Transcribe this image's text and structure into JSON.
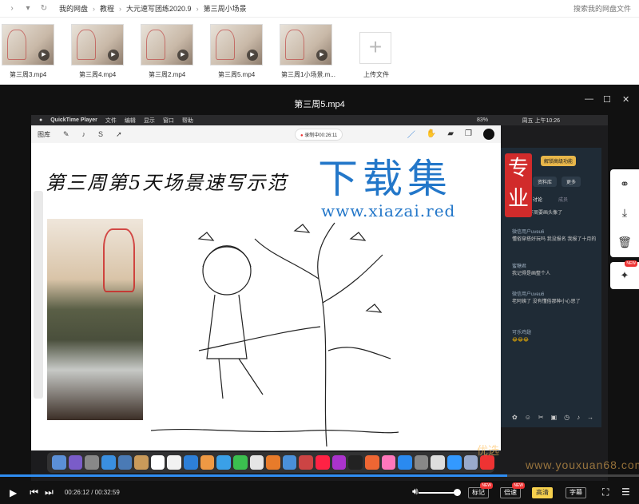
{
  "breadcrumb": [
    "我的网盘",
    "教程",
    "大元速写团练2020.9",
    "第三周小场景"
  ],
  "search": {
    "placeholder": "搜索我的网盘文件"
  },
  "thumbnails": [
    {
      "name": "第三周3.mp4"
    },
    {
      "name": "第三周4.mp4"
    },
    {
      "name": "第三周2.mp4"
    },
    {
      "name": "第三周5.mp4"
    },
    {
      "name": "第三周1小场景.m..."
    }
  ],
  "upload_label": "上传文件",
  "player": {
    "title": "第三周5.mp4",
    "current_time": "00:26:12",
    "duration": "00:32:59",
    "progress": 0.794,
    "volume": 0.9,
    "buttons": {
      "bookmark": "标记",
      "speed": "倍速",
      "quality": "高清",
      "subtitles": "字幕"
    },
    "new_badge": "NEW"
  },
  "video": {
    "mac_menu": [
      "QuickTime Player",
      "文件",
      "编辑",
      "显示",
      "窗口",
      "帮助"
    ],
    "mac_battery": "83%",
    "mac_clock": "周五 上午10:26",
    "app_gallery": "图库",
    "recording": "录制中00:26:11",
    "canvas_title": "第三周第5天场景速写示范",
    "chat": {
      "banner": "解锁高级功能",
      "buttons": [
        "资料库",
        "更多"
      ],
      "tabs": [
        "讨论",
        "成员"
      ],
      "messages": [
        {
          "user": "",
          "text": "~~~~~~下周要画头像了"
        },
        {
          "user": "微信用户uveu6",
          "text": "懂俗穿搭好玩吗 我没报名 我报了十月的"
        },
        {
          "user": "蜜糖君",
          "text": "我记得是画整个人"
        },
        {
          "user": "微信用户uveu6",
          "text": "老阿姨了 没有懂俗那种小心思了"
        },
        {
          "user": "可乐鸡翅",
          "text": "😂😂😂"
        }
      ]
    }
  },
  "watermark": {
    "title": "下载集",
    "url": "www.xiazai.red",
    "seal": "专业",
    "site_a": "优选",
    "site_b": "www.youxuan68.com"
  }
}
